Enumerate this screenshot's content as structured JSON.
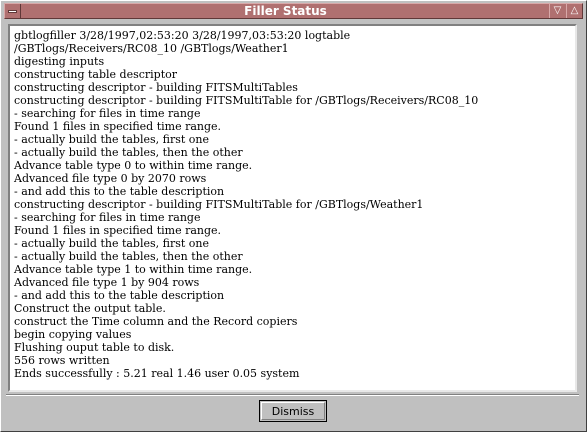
{
  "window": {
    "title": "Filler Status",
    "titlebar_color": "#b07070",
    "menu_icon": "window-menu-icon",
    "minimize_icon": "minimize-icon",
    "maximize_icon": "maximize-icon",
    "minimize_glyph": "▽",
    "maximize_glyph": "△"
  },
  "log": {
    "lines": [
      "gbtlogfiller 3/28/1997,02:53:20 3/28/1997,03:53:20 logtable",
      "/GBTlogs/Receivers/RC08_10 /GBTlogs/Weather1",
      "digesting inputs",
      "constructing table descriptor",
      "constructing descriptor - building FITSMultiTables",
      "constructing descriptor - building FITSMultiTable for /GBTlogs/Receivers/RC08_10",
      "- searching for files in time range",
      "Found 1 files in specified time range.",
      "- actually build the tables, first one",
      "- actually build the tables, then the other",
      "Advance table type 0 to within time range.",
      "Advanced file type 0 by 2070 rows",
      "- and add this to the table description",
      "constructing descriptor - building FITSMultiTable for /GBTlogs/Weather1",
      "- searching for files in time range",
      "Found 1 files in specified time range.",
      "- actually build the tables, first one",
      "- actually build the tables, then the other",
      "Advance table type 1 to within time range.",
      "Advanced file type 1 by 904 rows",
      "- and add this to the table description",
      "Construct the output table.",
      "construct the Time column and the Record copiers",
      "begin copying values",
      "Flushing ouput table to disk.",
      "556 rows written",
      "Ends successfully : 5.21 real 1.46 user 0.05 system"
    ]
  },
  "footer": {
    "dismiss_label": "Dismiss"
  }
}
